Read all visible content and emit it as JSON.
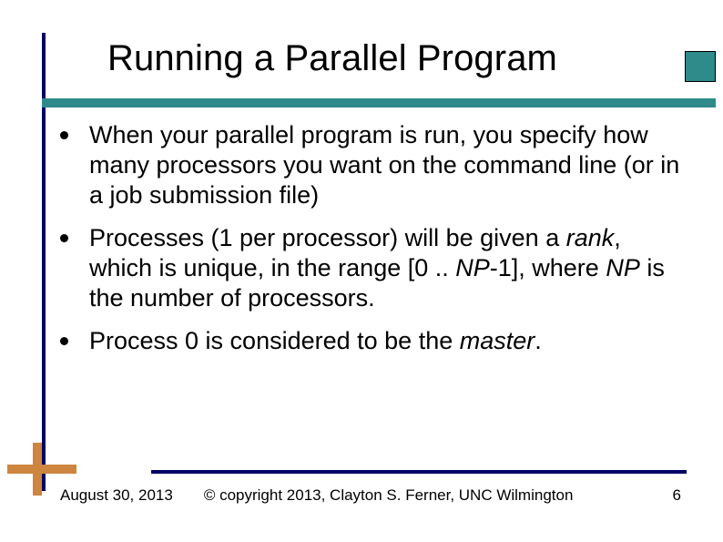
{
  "title": "Running a Parallel Program",
  "bullets": [
    {
      "segments": [
        [
          "When your parallel program is run, you specify how many processors you want on the command line (or in a job submission file)",
          0
        ]
      ]
    },
    {
      "segments": [
        [
          "Processes (1 per processor) will be given a ",
          0
        ],
        [
          "rank",
          1
        ],
        [
          ", which is unique, in the range [0 .. ",
          0
        ],
        [
          "NP",
          1
        ],
        [
          "-1], where ",
          0
        ],
        [
          "NP",
          1
        ],
        [
          " is the number of processors.",
          0
        ]
      ]
    },
    {
      "segments": [
        [
          "Process 0 is considered to be the ",
          0
        ],
        [
          "master",
          1
        ],
        [
          ".",
          0
        ]
      ]
    }
  ],
  "footer": {
    "date": "August 30, 2013",
    "copyright": "© copyright 2013, Clayton S. Ferner, UNC Wilmington",
    "page": "6"
  }
}
